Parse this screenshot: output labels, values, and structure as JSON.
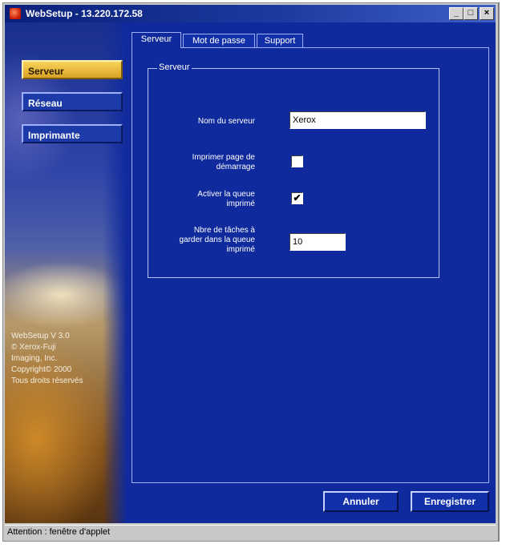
{
  "window": {
    "title": "WebSetup - 13.220.172.58",
    "min_glyph": "_",
    "max_glyph": "□",
    "close_glyph": "×"
  },
  "nav": {
    "items": [
      {
        "label": "Serveur",
        "active": true
      },
      {
        "label": "Réseau",
        "active": false
      },
      {
        "label": "Imprimante",
        "active": false
      }
    ]
  },
  "tabs": [
    {
      "label": "Serveur",
      "active": true
    },
    {
      "label": "Mot de passe",
      "active": false
    },
    {
      "label": "Support",
      "active": false
    }
  ],
  "group": {
    "title": "Serveur",
    "server_name_label": "Nom du serveur",
    "server_name_value": "Xerox",
    "print_startup_label_1": "Imprimer page de",
    "print_startup_label_2": "démarrage",
    "print_startup_checked": false,
    "enable_queue_label_1": "Activer la queue",
    "enable_queue_label_2": "imprimé",
    "enable_queue_checked": true,
    "jobs_label_1": "Nbre de tâches à",
    "jobs_label_2": "garder dans la queue",
    "jobs_label_3": "imprimé",
    "jobs_value": "10",
    "check_glyph": "✔"
  },
  "copyright": {
    "line1": "WebSetup V 3.0",
    "line2": "© Xerox-Fuji",
    "line3": "Imaging, Inc.",
    "line4": "Copyright© 2000",
    "line5": "Tous droits réservés"
  },
  "buttons": {
    "cancel": "Annuler",
    "save": "Enregistrer"
  },
  "status": {
    "text": "Attention : fenêtre d'applet"
  }
}
